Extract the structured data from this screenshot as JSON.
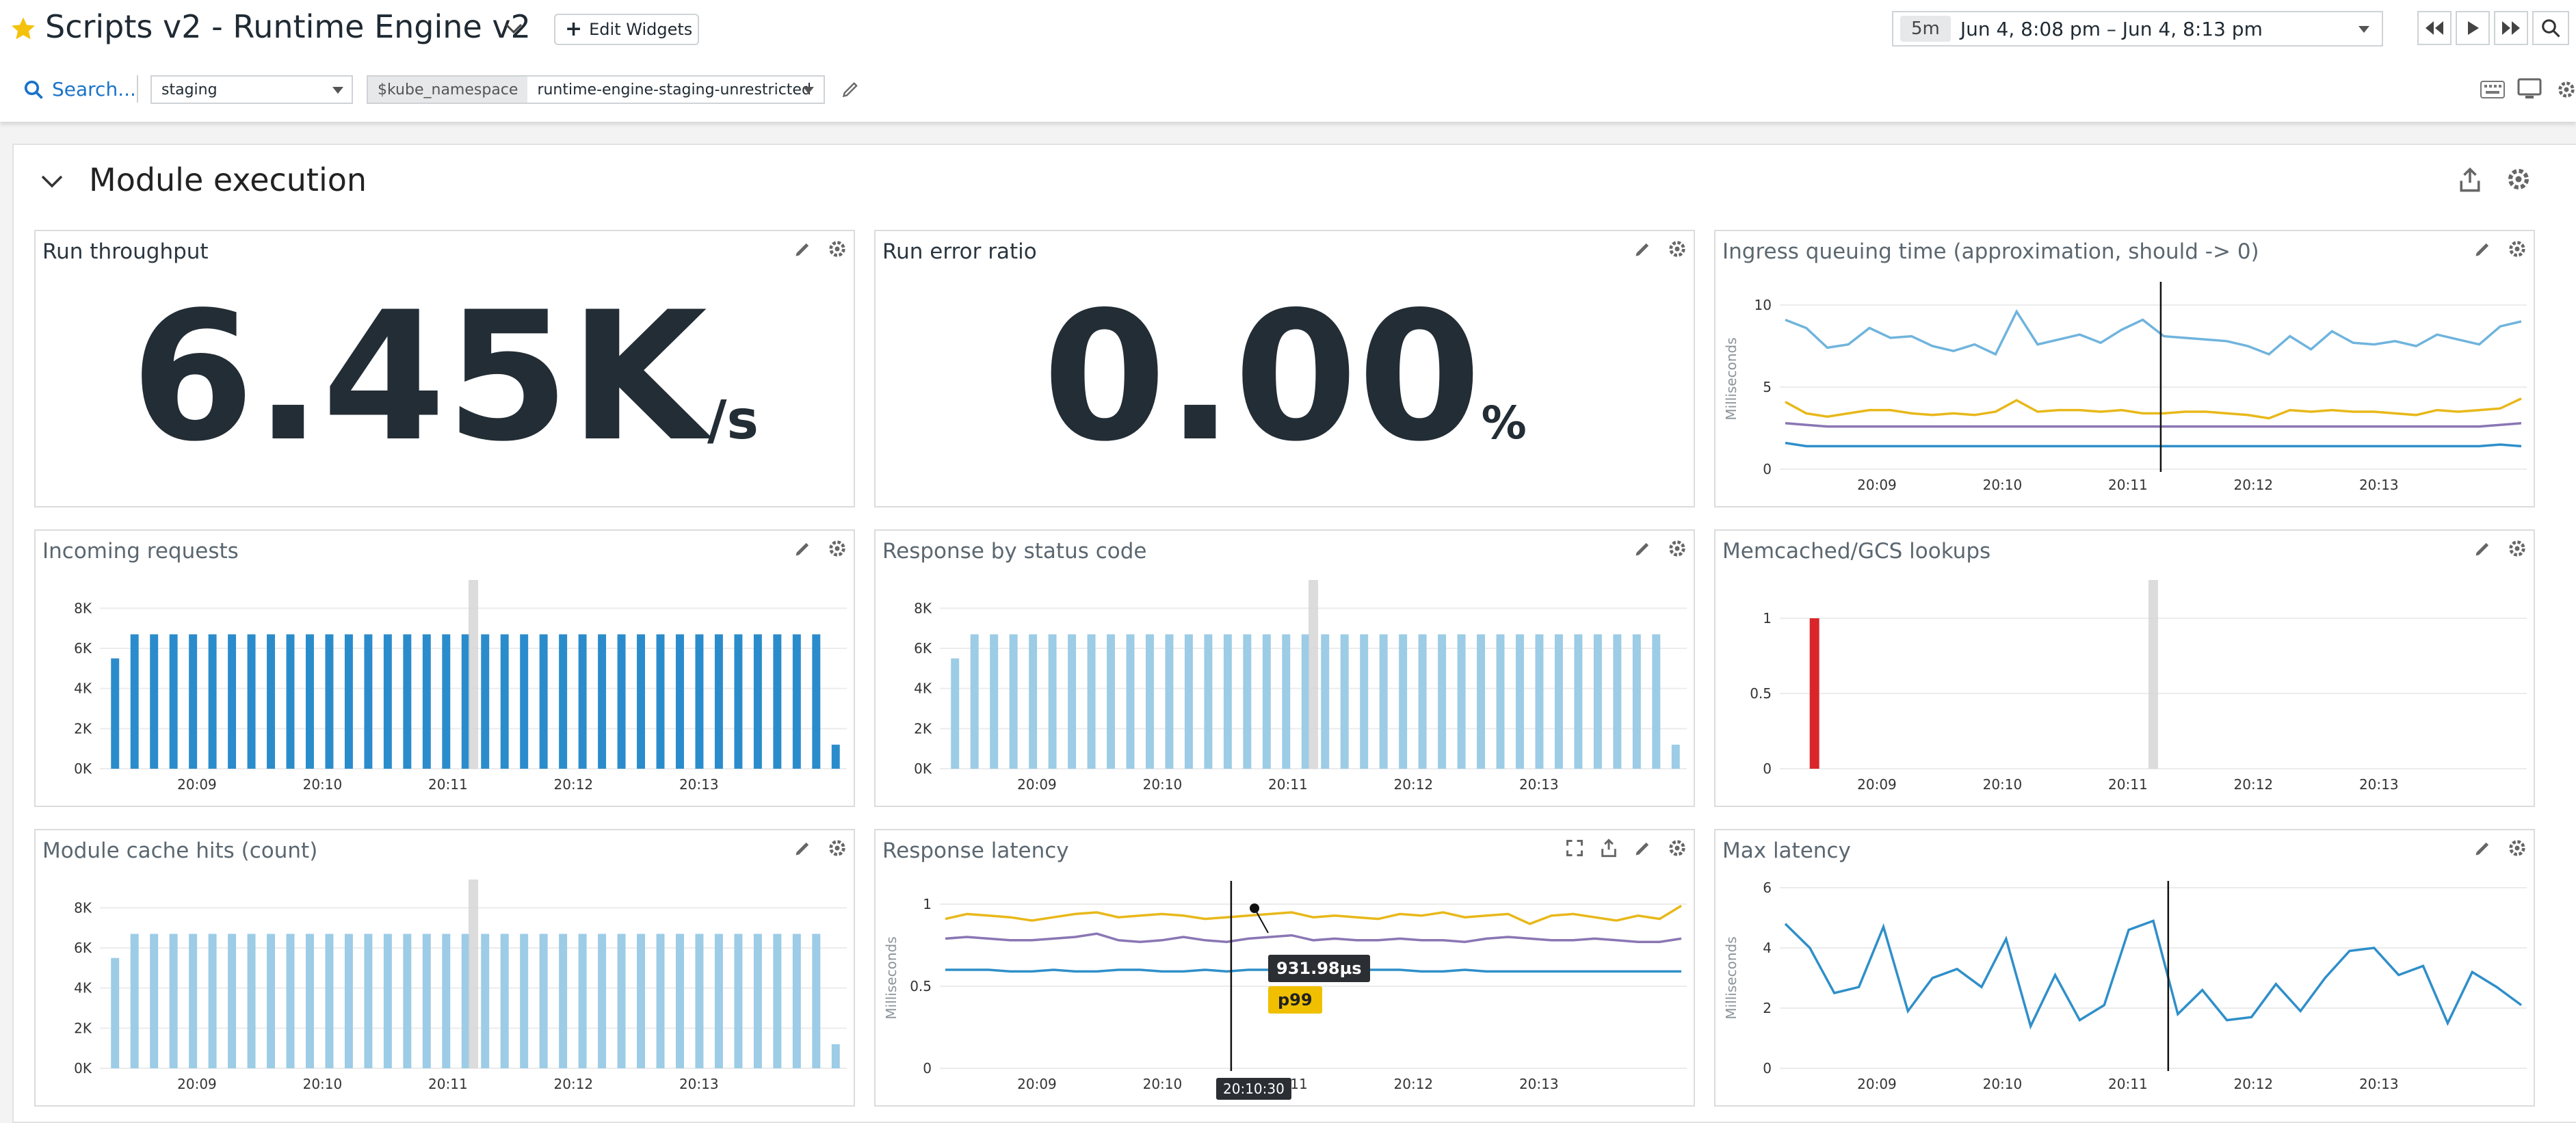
{
  "header": {
    "title": "Scripts v2 - Runtime Engine v2",
    "edit_widgets": "Edit Widgets",
    "time_range_badge": "5m",
    "time_range": "Jun 4, 8:08 pm – Jun 4, 8:13 pm",
    "search": "Search...",
    "env_value": "staging",
    "var_name": "$kube_namespace",
    "var_value": "runtime-engine-staging-unrestricted",
    "colors": {
      "star": "#f4c20d",
      "accent": "#1a73c8"
    }
  },
  "section": {
    "title": "Module execution"
  },
  "widgets": {
    "run_throughput": {
      "title": "Run throughput",
      "value": "6.45K",
      "unit": "/s"
    },
    "run_error_ratio": {
      "title": "Run error ratio",
      "value": "0.00",
      "unit": "%"
    },
    "ingress": {
      "title": "Ingress queuing time (approximation, should -> 0)"
    },
    "incoming": {
      "title": "Incoming requests"
    },
    "status_code": {
      "title": "Response by status code"
    },
    "memcached": {
      "title": "Memcached/GCS lookups"
    },
    "cache_hits": {
      "title": "Module cache hits (count)"
    },
    "latency": {
      "title": "Response latency",
      "tooltip_value": "931.98µs",
      "tooltip_series": "p99",
      "cursor_time": "20:10:30"
    },
    "max_latency": {
      "title": "Max latency"
    }
  },
  "chart_data": [
    {
      "id": "ingress",
      "type": "line",
      "ylabel": "Milliseconds",
      "ylim": [
        0,
        11
      ],
      "yticks": [
        0,
        5,
        10
      ],
      "xticks": [
        "20:09",
        "20:10",
        "20:11",
        "20:12",
        "20:13"
      ],
      "marker_x": 0.51,
      "series": [
        {
          "color": "#6fb4dd",
          "values": [
            9.1,
            8.6,
            7.4,
            7.6,
            8.6,
            8.0,
            8.1,
            7.5,
            7.2,
            7.6,
            7.0,
            9.6,
            7.6,
            7.9,
            8.2,
            7.7,
            8.5,
            9.1,
            8.1,
            8.0,
            7.9,
            7.8,
            7.5,
            7.0,
            8.1,
            7.3,
            8.4,
            7.7,
            7.6,
            7.8,
            7.5,
            8.2,
            7.9,
            7.6,
            8.7,
            9.0
          ]
        },
        {
          "color": "#e8b81a",
          "values": [
            4.1,
            3.4,
            3.2,
            3.4,
            3.6,
            3.6,
            3.4,
            3.3,
            3.4,
            3.3,
            3.5,
            4.2,
            3.5,
            3.6,
            3.6,
            3.5,
            3.6,
            3.4,
            3.4,
            3.5,
            3.5,
            3.4,
            3.3,
            3.1,
            3.6,
            3.5,
            3.6,
            3.5,
            3.5,
            3.4,
            3.3,
            3.6,
            3.5,
            3.6,
            3.7,
            4.3
          ]
        },
        {
          "color": "#8a76b4",
          "values": [
            2.8,
            2.7,
            2.6,
            2.6,
            2.6,
            2.6,
            2.6,
            2.6,
            2.6,
            2.6,
            2.6,
            2.6,
            2.6,
            2.6,
            2.6,
            2.6,
            2.6,
            2.6,
            2.6,
            2.6,
            2.6,
            2.6,
            2.6,
            2.6,
            2.6,
            2.6,
            2.6,
            2.6,
            2.6,
            2.6,
            2.6,
            2.6,
            2.6,
            2.6,
            2.7,
            2.8
          ]
        },
        {
          "color": "#2f8fc9",
          "values": [
            1.6,
            1.4,
            1.4,
            1.4,
            1.4,
            1.4,
            1.4,
            1.4,
            1.4,
            1.4,
            1.4,
            1.4,
            1.4,
            1.4,
            1.4,
            1.4,
            1.4,
            1.4,
            1.4,
            1.4,
            1.4,
            1.4,
            1.4,
            1.4,
            1.4,
            1.4,
            1.4,
            1.4,
            1.4,
            1.4,
            1.4,
            1.4,
            1.4,
            1.4,
            1.5,
            1.4
          ]
        }
      ]
    },
    {
      "id": "incoming",
      "type": "bar",
      "ylim": [
        0,
        9000
      ],
      "yticks": [
        0,
        2000,
        4000,
        6000,
        8000
      ],
      "ytick_labels": [
        "0K",
        "2K",
        "4K",
        "6K",
        "8K"
      ],
      "xticks": [
        "20:09",
        "20:10",
        "20:11",
        "20:12",
        "20:13"
      ],
      "marker_x": 0.5,
      "color": "#2b8ccc",
      "values": [
        5500,
        6700,
        6700,
        6700,
        6700,
        6700,
        6700,
        6700,
        6700,
        6700,
        6700,
        6700,
        6700,
        6700,
        6700,
        6700,
        6700,
        6700,
        6700,
        6700,
        6700,
        6700,
        6700,
        6700,
        6700,
        6700,
        6700,
        6700,
        6700,
        6700,
        6700,
        6700,
        6700,
        6700,
        6700,
        6700,
        6700,
        1200
      ]
    },
    {
      "id": "status_code",
      "type": "bar",
      "ylim": [
        0,
        9000
      ],
      "yticks": [
        0,
        2000,
        4000,
        6000,
        8000
      ],
      "ytick_labels": [
        "0K",
        "2K",
        "4K",
        "6K",
        "8K"
      ],
      "xticks": [
        "20:09",
        "20:10",
        "20:11",
        "20:12",
        "20:13"
      ],
      "marker_x": 0.5,
      "color": "#9ccce6",
      "values": [
        5500,
        6700,
        6700,
        6700,
        6700,
        6700,
        6700,
        6700,
        6700,
        6700,
        6700,
        6700,
        6700,
        6700,
        6700,
        6700,
        6700,
        6700,
        6700,
        6700,
        6700,
        6700,
        6700,
        6700,
        6700,
        6700,
        6700,
        6700,
        6700,
        6700,
        6700,
        6700,
        6700,
        6700,
        6700,
        6700,
        6700,
        1200
      ]
    },
    {
      "id": "memcached",
      "type": "bar",
      "ylim": [
        0,
        1.2
      ],
      "yticks": [
        0,
        0.5,
        1
      ],
      "ytick_labels": [
        "0",
        "0.5",
        "1"
      ],
      "xticks": [
        "20:09",
        "20:10",
        "20:11",
        "20:12",
        "20:13"
      ],
      "marker_x": 0.5,
      "color": "#d9262a",
      "values": [
        1
      ]
    },
    {
      "id": "cache_hits",
      "type": "bar",
      "ylim": [
        0,
        9000
      ],
      "yticks": [
        0,
        2000,
        4000,
        6000,
        8000
      ],
      "ytick_labels": [
        "0K",
        "2K",
        "4K",
        "6K",
        "8K"
      ],
      "xticks": [
        "20:09",
        "20:10",
        "20:11",
        "20:12",
        "20:13"
      ],
      "marker_x": 0.5,
      "color": "#9ccce6",
      "values": [
        5500,
        6700,
        6700,
        6700,
        6700,
        6700,
        6700,
        6700,
        6700,
        6700,
        6700,
        6700,
        6700,
        6700,
        6700,
        6700,
        6700,
        6700,
        6700,
        6700,
        6700,
        6700,
        6700,
        6700,
        6700,
        6700,
        6700,
        6700,
        6700,
        6700,
        6700,
        6700,
        6700,
        6700,
        6700,
        6700,
        6700,
        1200
      ]
    },
    {
      "id": "latency",
      "type": "line",
      "ylabel": "Milliseconds",
      "ylim": [
        0,
        1.1
      ],
      "yticks": [
        0,
        0.5,
        1
      ],
      "xticks": [
        "20:09",
        "20:10",
        "20:11",
        "20:12",
        "20:13"
      ],
      "marker_x": 0.39,
      "series": [
        {
          "color": "#e8b81a",
          "values": [
            0.91,
            0.94,
            0.93,
            0.92,
            0.9,
            0.92,
            0.94,
            0.95,
            0.92,
            0.93,
            0.94,
            0.93,
            0.91,
            0.92,
            0.93,
            0.94,
            0.95,
            0.92,
            0.93,
            0.92,
            0.91,
            0.94,
            0.93,
            0.95,
            0.92,
            0.93,
            0.94,
            0.88,
            0.93,
            0.94,
            0.92,
            0.9,
            0.93,
            0.91,
            0.99
          ]
        },
        {
          "color": "#8a76b4",
          "values": [
            0.79,
            0.8,
            0.79,
            0.78,
            0.78,
            0.79,
            0.8,
            0.82,
            0.78,
            0.77,
            0.78,
            0.8,
            0.78,
            0.77,
            0.79,
            0.8,
            0.81,
            0.78,
            0.79,
            0.78,
            0.78,
            0.79,
            0.78,
            0.78,
            0.77,
            0.79,
            0.8,
            0.79,
            0.78,
            0.78,
            0.79,
            0.78,
            0.77,
            0.77,
            0.79
          ]
        },
        {
          "color": "#2f8fc9",
          "values": [
            0.6,
            0.6,
            0.6,
            0.59,
            0.59,
            0.6,
            0.59,
            0.59,
            0.6,
            0.6,
            0.59,
            0.59,
            0.6,
            0.59,
            0.6,
            0.6,
            0.6,
            0.59,
            0.59,
            0.6,
            0.6,
            0.6,
            0.59,
            0.59,
            0.6,
            0.59,
            0.59,
            0.59,
            0.59,
            0.59,
            0.59,
            0.59,
            0.59,
            0.59,
            0.59
          ]
        }
      ]
    },
    {
      "id": "max_latency",
      "type": "line",
      "ylabel": "Milliseconds",
      "ylim": [
        0,
        6
      ],
      "yticks": [
        0,
        2,
        4,
        6
      ],
      "xticks": [
        "20:09",
        "20:10",
        "20:11",
        "20:12",
        "20:13"
      ],
      "marker_x": 0.52,
      "series": [
        {
          "color": "#2f8fc9",
          "values": [
            4.8,
            4.0,
            2.5,
            2.7,
            4.7,
            1.9,
            3.0,
            3.3,
            2.7,
            4.3,
            1.4,
            3.1,
            1.6,
            2.1,
            4.6,
            4.9,
            1.8,
            2.6,
            1.6,
            1.7,
            2.8,
            1.9,
            3.0,
            3.9,
            4.0,
            3.1,
            3.4,
            1.5,
            3.2,
            2.7,
            2.1
          ]
        }
      ]
    }
  ]
}
